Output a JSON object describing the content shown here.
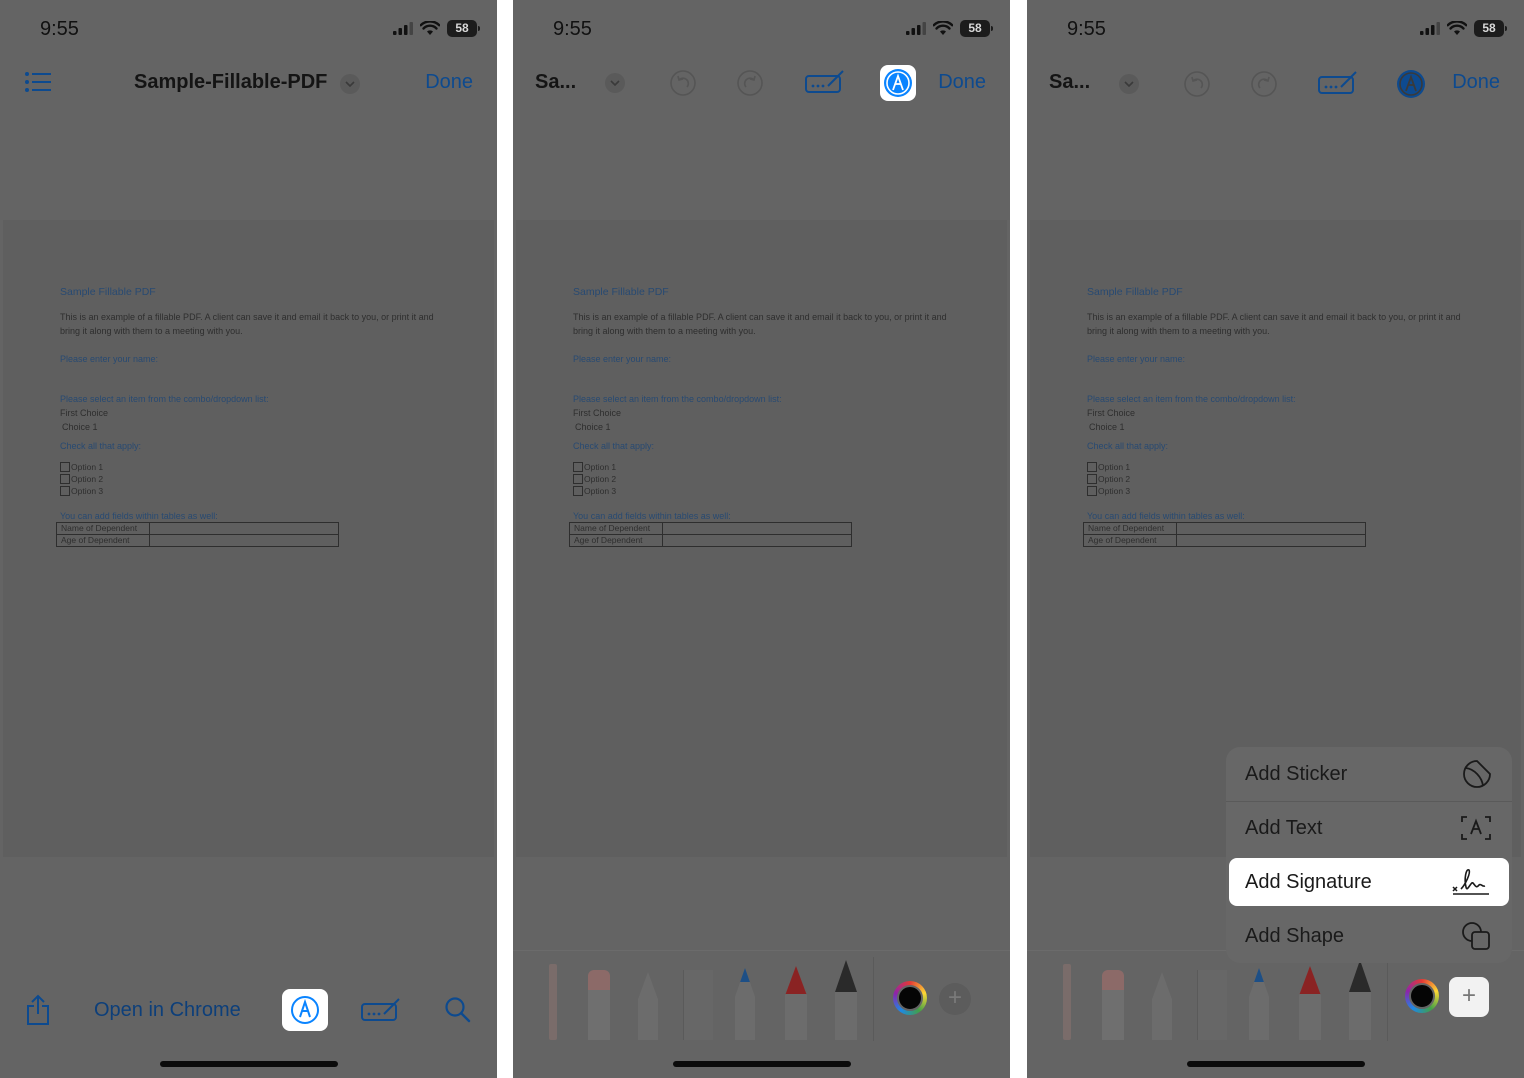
{
  "status": {
    "time": "9:55",
    "battery": "58"
  },
  "screens": [
    {
      "nav": {
        "title": "Sample-Fillable-PDF",
        "done": "Done"
      },
      "bottom_bar": {
        "open_in": "Open in Chrome"
      }
    },
    {
      "nav": {
        "title": "Sa...",
        "done": "Done"
      }
    },
    {
      "nav": {
        "title": "Sa...",
        "done": "Done"
      },
      "add_menu": {
        "items": [
          "Add Sticker",
          "Add Text",
          "Add Signature",
          "Add Shape"
        ],
        "selected": "Add Signature"
      }
    }
  ],
  "document": {
    "title": "Sample Fillable PDF",
    "paragraph": "This is an example of a fillable PDF. A client can save it and email it back to you, or print it and bring it along with them to a meeting with you.",
    "name_prompt": "Please enter your name:",
    "combo_prompt": "Please select an item from the combo/dropdown list:",
    "combo_header": "First Choice",
    "combo_value": "Choice 1",
    "check_prompt": "Check all that apply:",
    "options": [
      "Option 1",
      "Option 2",
      "Option 3"
    ],
    "table_prompt": "You can add  fields within tables as well:",
    "table_rows": [
      "Name of Dependent",
      "Age of Dependent"
    ]
  },
  "colors": {
    "accent": "#0a84ff",
    "overlay": "#646464",
    "done": "#0d4a8f"
  },
  "icons": [
    "list-icon",
    "chevron-down-icon",
    "markup-icon",
    "undo-icon",
    "redo-icon",
    "form-fill-icon",
    "share-icon",
    "search-icon",
    "sticker-icon",
    "text-box-icon",
    "signature-icon",
    "shape-icon",
    "plus-icon"
  ]
}
